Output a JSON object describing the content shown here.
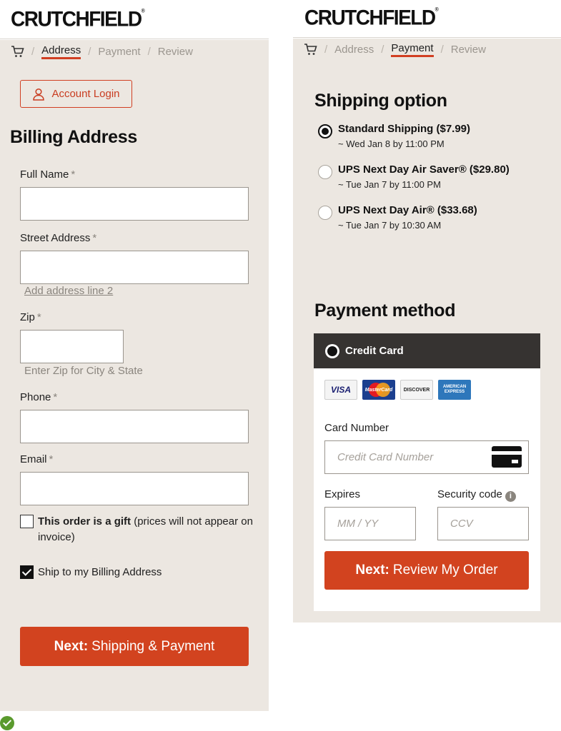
{
  "brand": {
    "logo_text": "CRUTCHFIELD",
    "accent_color": "#d2431f",
    "panel_bg": "#ece7e1"
  },
  "left": {
    "breadcrumb": {
      "icon": "cart-icon",
      "items": [
        "Address",
        "Payment",
        "Review"
      ],
      "active": "Address"
    },
    "account_login": "Account Login",
    "heading": "Billing Address",
    "fields": {
      "full_name": {
        "label": "Full Name",
        "value": ""
      },
      "street": {
        "label": "Street Address",
        "value": ""
      },
      "add_line2": "Add address line 2",
      "zip": {
        "label": "Zip",
        "value": ""
      },
      "zip_helper": "Enter Zip for City & State",
      "phone": {
        "label": "Phone",
        "value": ""
      },
      "email": {
        "label": "Email",
        "value": ""
      },
      "required_mark": "*"
    },
    "gift": {
      "bold": "This order is a gift",
      "rest": " (prices will not appear on invoice)",
      "checked": false
    },
    "ship_to_billing": {
      "label": "Ship to my Billing Address",
      "checked": true
    },
    "next_button": {
      "bold": "Next:",
      "rest": "Shipping & Payment"
    }
  },
  "right": {
    "breadcrumb": {
      "icon": "cart-icon",
      "items": [
        "Address",
        "Payment",
        "Review"
      ],
      "active": "Payment"
    },
    "shipping_heading": "Shipping option",
    "shipping_options": [
      {
        "title": "Standard Shipping ($7.99)",
        "eta": "~ Wed Jan 8 by 11:00 PM",
        "selected": true
      },
      {
        "title": "UPS Next Day Air Saver® ($29.80)",
        "eta": "~ Tue Jan 7 by 11:00 PM",
        "selected": false
      },
      {
        "title": "UPS Next Day Air® ($33.68)",
        "eta": "~ Tue Jan 7 by 10:30 AM",
        "selected": false
      }
    ],
    "payment_heading": "Payment method",
    "credit_card": {
      "tab_label": "Credit Card",
      "logos": [
        "VISA",
        "MasterCard",
        "DISCOVER",
        "AMERICAN EXPRESS"
      ],
      "card_number_label": "Card Number",
      "card_number_placeholder": "Credit Card Number",
      "expires_label": "Expires",
      "expires_placeholder": "MM / YY",
      "security_label": "Security code",
      "security_placeholder": "CCV"
    },
    "next_button": {
      "bold": "Next:",
      "rest": "Review My Order"
    }
  }
}
